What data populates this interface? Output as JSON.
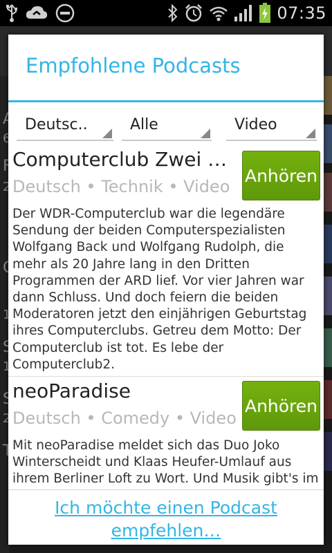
{
  "status_bar": {
    "time": "07:35",
    "icons_left": [
      "usb-icon",
      "cloud-sync-icon",
      "do-not-disturb-icon"
    ],
    "icons_right": [
      "bluetooth-icon",
      "alarm-icon",
      "wifi-icon",
      "signal-icon",
      "battery-charging-icon"
    ],
    "battery_color": "#8cc63f"
  },
  "background": {
    "list_letters": [
      "A",
      "6",
      "F",
      "2",
      "C",
      "1",
      "S",
      "1",
      "S",
      "2",
      "T"
    ]
  },
  "dialog": {
    "title": "Empfohlene Podcasts",
    "accent_color": "#33b5e5",
    "filters": [
      {
        "label": "Deutsc..",
        "name": "language-filter"
      },
      {
        "label": "Alle",
        "name": "category-filter"
      },
      {
        "label": "Video",
        "name": "media-filter"
      }
    ],
    "items": [
      {
        "title": "Computerclub Zwei Vi…",
        "meta": "Deutsch • Technik • Video",
        "description": "Der WDR-Computerclub war die legendäre Sendung der beiden Computerspezialisten Wolfgang Back und Wolfgang Rudolph, die mehr als 20 Jahre lang in den Dritten Programmen der ARD lief. Vor vier Jahren war dann Schluss. Und doch feiern die beiden Moderatoren jetzt den einjährigen Geburtstag ihres Computerclubs. Getreu dem Motto: Der Computerclub ist tot. Es lebe der Computerclub2.",
        "button": "Anhören"
      },
      {
        "title": "neoParadise",
        "meta": "Deutsch • Comedy • Video",
        "description": "Mit neoParadise meldet sich das Duo Joko Winterscheidt und Klaas Heufer-Umlauf aus ihrem Berliner Loft zu Wort. Und Musik gibt's im ...",
        "button": "Anhören"
      }
    ],
    "button_color": "#6aa80c",
    "recommend_link": "Ich möchte einen Podcast empfehlen…"
  }
}
